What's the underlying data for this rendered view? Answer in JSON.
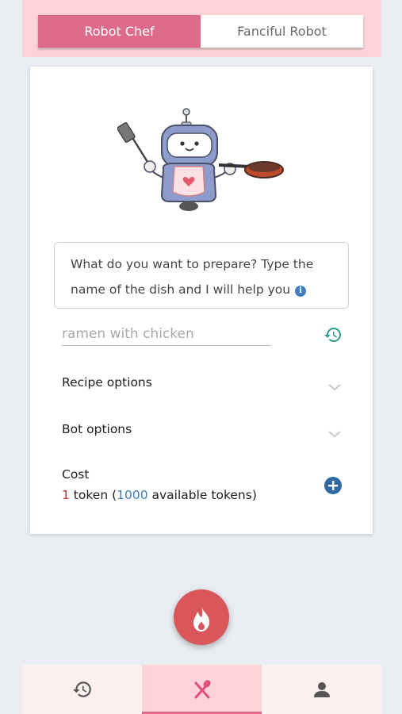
{
  "tabs": [
    {
      "label": "Robot Chef",
      "active": true
    },
    {
      "label": "Fanciful Robot",
      "active": false
    }
  ],
  "prompt": {
    "text": "What do you want to prepare? Type the name of the dish and I will help you",
    "info_icon": "info-icon"
  },
  "dish_input": {
    "placeholder": "ramen with chicken",
    "value": ""
  },
  "options": [
    {
      "label": "Recipe options",
      "icon": "chevron-down-icon"
    },
    {
      "label": "Bot options",
      "icon": "chevron-down-icon"
    }
  ],
  "cost": {
    "title": "Cost",
    "amount": "1",
    "unit": " token (",
    "available": "1000",
    "available_suffix": " available tokens)"
  },
  "fab_icon": "flame-icon",
  "nav": [
    {
      "icon": "history-icon",
      "active": false
    },
    {
      "icon": "utensils-icon",
      "active": true
    },
    {
      "icon": "user-icon",
      "active": false
    }
  ],
  "colors": {
    "accent_pink": "#df6b8b",
    "header_pink": "#fbd3d8",
    "fab_red": "#d9565b",
    "teal": "#2a9d8f",
    "blue": "#3f7fbf"
  }
}
